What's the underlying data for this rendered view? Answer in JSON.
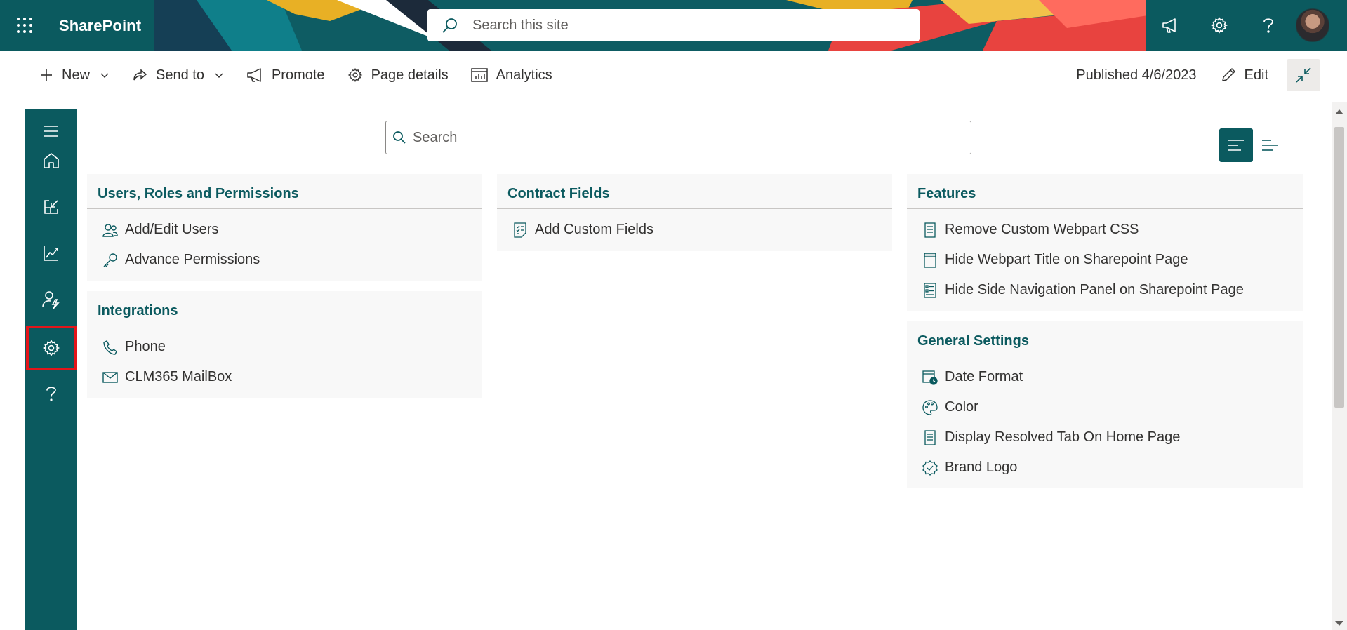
{
  "suite": {
    "brand": "SharePoint",
    "search_placeholder": "Search this site"
  },
  "commandbar": {
    "new_label": "New",
    "send_to_label": "Send to",
    "promote_label": "Promote",
    "page_details_label": "Page details",
    "analytics_label": "Analytics",
    "published_text": "Published 4/6/2023",
    "edit_label": "Edit"
  },
  "main": {
    "search_placeholder": "Search"
  },
  "cards": {
    "users": {
      "title": "Users, Roles and Permissions",
      "items": [
        "Add/Edit Users",
        "Advance Permissions"
      ]
    },
    "integrations": {
      "title": "Integrations",
      "items": [
        "Phone",
        "CLM365 MailBox"
      ]
    },
    "contract_fields": {
      "title": "Contract Fields",
      "items": [
        "Add Custom Fields"
      ]
    },
    "features": {
      "title": "Features",
      "items": [
        "Remove Custom Webpart CSS",
        "Hide Webpart Title on Sharepoint Page",
        "Hide Side Navigation Panel on Sharepoint Page"
      ]
    },
    "general": {
      "title": "General Settings",
      "items": [
        "Date Format",
        "Color",
        "Display Resolved Tab On Home Page",
        "Brand Logo"
      ]
    }
  },
  "colors": {
    "accent": "#0b5a5f",
    "highlight_border": "#e3151a"
  }
}
